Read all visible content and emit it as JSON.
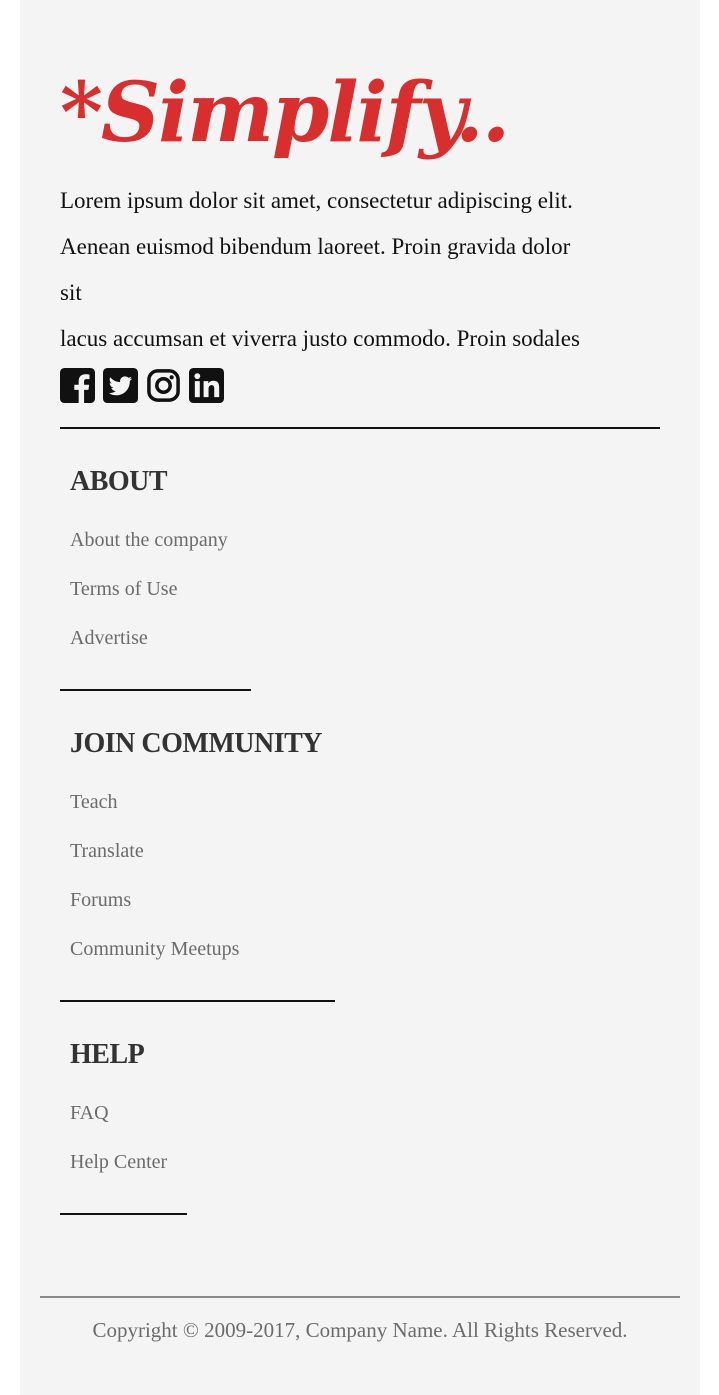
{
  "brand": {
    "logo_text": "*Simplify..",
    "description_lines": [
      "Lorem ipsum dolor sit amet, consectetur adipiscing elit.",
      "Aenean euismod bibendum laoreet. Proin gravida dolor",
      "sit",
      "lacus accumsan et viverra justo commodo. Proin sodales"
    ],
    "colors": {
      "logo": "#d92e2e"
    }
  },
  "social": [
    {
      "icon": "facebook-icon"
    },
    {
      "icon": "twitter-icon"
    },
    {
      "icon": "instagram-icon"
    },
    {
      "icon": "linkedin-icon"
    }
  ],
  "sections": [
    {
      "title": "ABOUT",
      "links": [
        "About the company",
        "Terms of Use",
        "Advertise"
      ]
    },
    {
      "title": "JOIN COMMUNITY",
      "links": [
        "Teach",
        "Translate",
        "Forums",
        "Community Meetups"
      ]
    },
    {
      "title": "HELP",
      "links": [
        "FAQ",
        "Help Center"
      ]
    }
  ],
  "copyright": "Copyright © 2009-2017, Company Name. All Rights Reserved."
}
